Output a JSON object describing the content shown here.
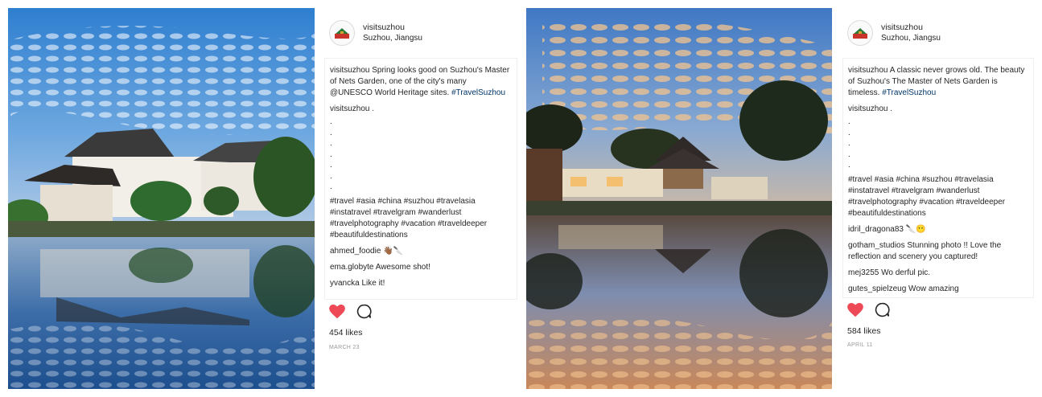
{
  "colors": {
    "heart": "#ed4956",
    "link": "#003569",
    "muted": "#999999"
  },
  "posts": [
    {
      "username": "visitsuzhou",
      "location": "Suzhou, Jiangsu",
      "caption_user": "visitsuzhou",
      "caption_text": " Spring looks good on Suzhou's Master of Nets Garden, one of the city's many @UNESCO World Heritage sites. ",
      "caption_tag": "#TravelSuzhou",
      "comment2_user": "visitsuzhou",
      "comment2_text": " .",
      "dots": ".\n.\n.\n.\n.\n.\n.",
      "hashtags": "#travel #asia #china #suzhou #travelasia #instatravel #travelgram #wanderlust #travelphotography #vacation #traveldeeper #beautifuldestinations",
      "comments": [
        {
          "user": "ahmed_foodie",
          "text": " 👋🏾🔪"
        },
        {
          "user": "ema.globyte",
          "text": " Awesome shot!"
        },
        {
          "user": "yvancka",
          "text": " Like it!"
        }
      ],
      "likes": "454 likes",
      "date": "MARCH 23",
      "heart_icon": "heart-filled-icon",
      "comment_icon": "comment-bubble-icon"
    },
    {
      "username": "visitsuzhou",
      "location": "Suzhou, Jiangsu",
      "caption_user": "visitsuzhou",
      "caption_text": " A classic never grows old. The beauty of Suzhou's The Master of Nets Garden is timeless. ",
      "caption_tag": "#TravelSuzhou",
      "comment2_user": "visitsuzhou",
      "comment2_text": " .",
      "dots": ".\n.\n.\n.\n.",
      "hashtags": "#travel #asia #china #suzhou #travelasia #instatravel #travelgram #wanderlust #travelphotography #vacation #traveldeeper #beautifuldestinations",
      "comments": [
        {
          "user": "idril_dragona83",
          "text": " 🔪😶"
        },
        {
          "user": "gotham_studios",
          "text": " Stunning photo !! Love the reflection and scenery you captured!"
        },
        {
          "user": "mej3255",
          "text": " Wo derful pic."
        },
        {
          "user": "gutes_spielzeug",
          "text": " Wow amazing"
        }
      ],
      "likes": "584 likes",
      "date": "APRIL 11",
      "heart_icon": "heart-filled-icon",
      "comment_icon": "comment-bubble-icon"
    }
  ]
}
